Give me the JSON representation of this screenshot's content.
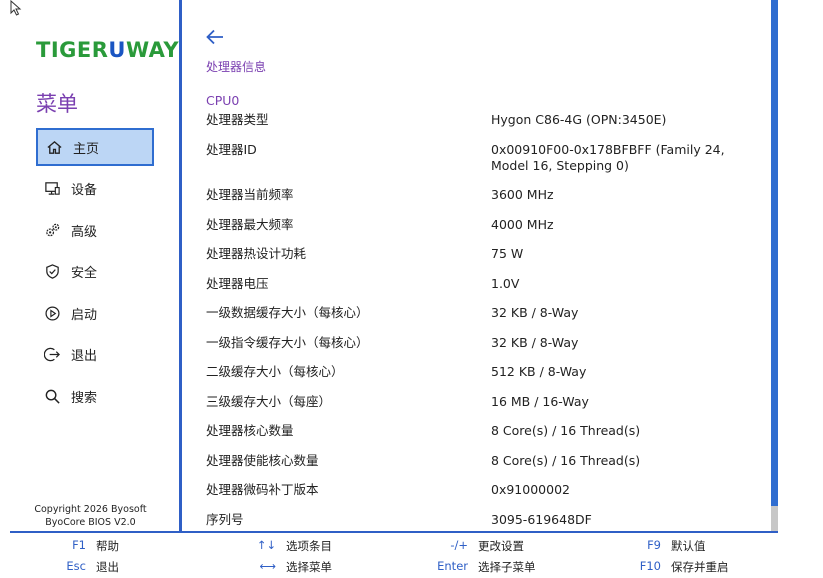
{
  "logo": {
    "part1": "TIGER",
    "part2": "U",
    "part3": "WAY",
    "wave": "W"
  },
  "sidebar": {
    "title": "菜单",
    "items": [
      {
        "label": "主页",
        "icon": "home-icon",
        "active": true
      },
      {
        "label": "设备",
        "icon": "device-icon",
        "active": false
      },
      {
        "label": "高级",
        "icon": "gears-icon",
        "active": false
      },
      {
        "label": "安全",
        "icon": "shield-icon",
        "active": false
      },
      {
        "label": "启动",
        "icon": "play-icon",
        "active": false
      },
      {
        "label": "退出",
        "icon": "exit-icon",
        "active": false
      },
      {
        "label": "搜索",
        "icon": "search-icon",
        "active": false
      }
    ],
    "copyright_line1": "Copyright 2026 Byosoft",
    "copyright_line2": "ByoCore BIOS V2.0"
  },
  "main": {
    "breadcrumb": "处理器信息",
    "section": "CPU0",
    "rows": [
      {
        "key": "处理器类型",
        "value": "Hygon C86-4G (OPN:3450E)"
      },
      {
        "key": "处理器ID",
        "value": "0x00910F00-0x178BFBFF (Family 24, Model 16, Stepping 0)"
      },
      {
        "key": "处理器当前频率",
        "value": "3600 MHz"
      },
      {
        "key": "处理器最大频率",
        "value": "4000 MHz"
      },
      {
        "key": "处理器热设计功耗",
        "value": "75 W"
      },
      {
        "key": "处理器电压",
        "value": "1.0V"
      },
      {
        "key": "一级数据缓存大小（每核心）",
        "value": "32 KB / 8-Way"
      },
      {
        "key": "一级指令缓存大小（每核心）",
        "value": "32 KB / 8-Way"
      },
      {
        "key": "二级缓存大小（每核心）",
        "value": "512 KB / 8-Way"
      },
      {
        "key": "三级缓存大小（每座）",
        "value": "16 MB / 16-Way"
      },
      {
        "key": "处理器核心数量",
        "value": "8 Core(s) / 16 Thread(s)"
      },
      {
        "key": "处理器使能核心数量",
        "value": "8 Core(s) / 16 Thread(s)"
      },
      {
        "key": "处理器微码补丁版本",
        "value": "0x91000002"
      },
      {
        "key": "序列号",
        "value": "3095-619648DF"
      }
    ]
  },
  "footer": [
    {
      "key": "F1",
      "action": "帮助"
    },
    {
      "key": "↑↓",
      "action": "选项条目"
    },
    {
      "key": "-/+",
      "action": "更改设置"
    },
    {
      "key": "F9",
      "action": "默认值"
    },
    {
      "key": "Esc",
      "action": "退出"
    },
    {
      "key": "⟷",
      "action": "选择菜单"
    },
    {
      "key": "Enter",
      "action": "选择子菜单"
    },
    {
      "key": "F10",
      "action": "保存并重启"
    }
  ],
  "colors": {
    "accent": "#2f5fc6",
    "purple": "#7a3fb0",
    "active_bg": "#bcd6f5",
    "logo_green": "#2a9a3a"
  }
}
